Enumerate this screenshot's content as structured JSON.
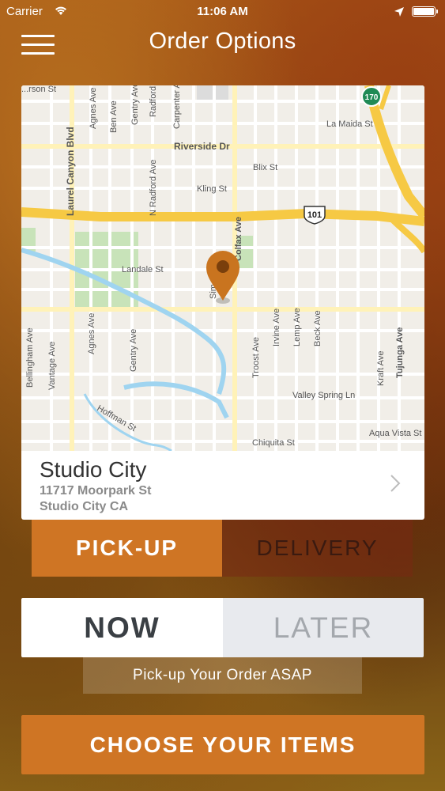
{
  "status_bar": {
    "carrier": "Carrier",
    "time": "11:06 AM"
  },
  "nav": {
    "title": "Order Options"
  },
  "map": {
    "streets": [
      "Laurel Canyon Blvd",
      "Agnes Ave",
      "Ben Ave",
      "Agnes Ave",
      "Gentry Ave",
      "Radford Ave",
      "Carpenter Ave",
      "La Maida St",
      "Riverside Dr",
      "Blix St",
      "Kling St",
      "N Radford Ave",
      "Colfax Ave",
      "Landale St",
      "Sim... Ave",
      "Troost Ave",
      "Irvine Ave",
      "Lemp Ave",
      "Beck Ave",
      "Tujunga Ave",
      "Kraft Ave",
      "Bellingham Ave",
      "Vantage Ave",
      "Agnes Ave",
      "Gentry Ave",
      "Valley Spring Ln",
      "Hoffman St",
      "Chiquita St",
      "Aqua Vista St",
      "...rson St"
    ],
    "highway_101": "101",
    "highway_170": "170"
  },
  "location": {
    "name": "Studio City",
    "address_line1": "11717 Moorpark St",
    "address_line2": "Studio City CA"
  },
  "fulfillment": {
    "pickup_label": "PICK-UP",
    "delivery_label": "DELIVERY",
    "selected": "pickup"
  },
  "timing": {
    "now_label": "NOW",
    "later_label": "LATER",
    "selected": "now"
  },
  "hint": "Pick-up Your Order ASAP",
  "cta": {
    "label": "CHOOSE YOUR ITEMS"
  },
  "colors": {
    "accent": "#cf7524",
    "pin": "#c9741f"
  }
}
